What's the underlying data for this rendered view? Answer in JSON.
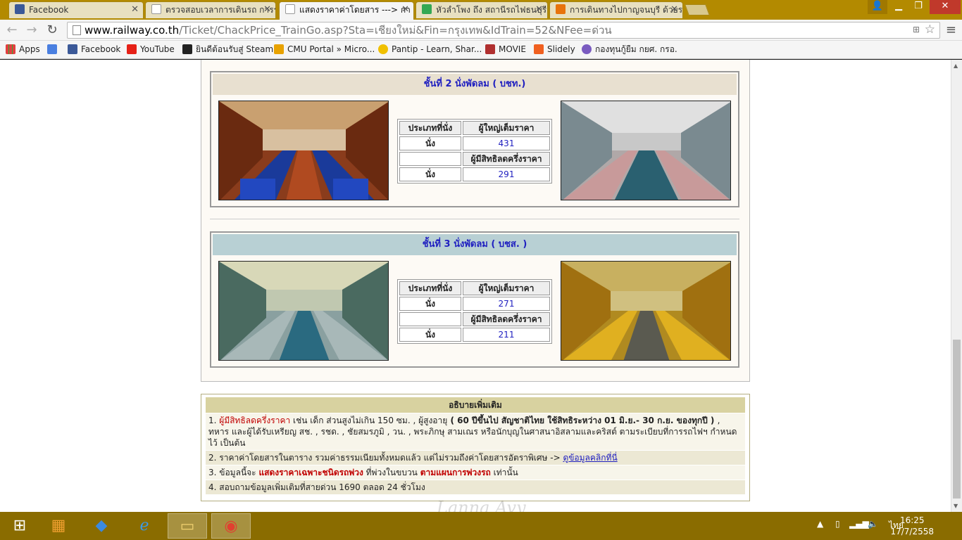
{
  "tabs": [
    {
      "title": "Facebook",
      "icon": "facebook-icon",
      "color": "#3b5998"
    },
    {
      "title": "ตรวจสอบเวลาการเดินรถ การร",
      "icon": "page-icon",
      "color": "#cccccc"
    },
    {
      "title": "แสดงราคาค่าโดยสาร ---> กา",
      "icon": "page-icon",
      "color": "#cccccc"
    },
    {
      "title": "หัวลำโพง ถึง สถานีรถไฟธนบุรี",
      "icon": "maps-icon",
      "color": "#34a853"
    },
    {
      "title": "การเดินทางไปกาญจนบุรี ด้วยร",
      "icon": "k-icon",
      "color": "#e8730c"
    }
  ],
  "address": {
    "host": "www.railway.co.th",
    "path": "/Ticket/ChackPrice_TrainGo.asp?Sta=เชียงใหม่&Fin=กรุงเทพ&IdTrain=52&NFee=ด่วน"
  },
  "bookmarks": [
    {
      "label": "Apps",
      "icon": "apps-grid-icon",
      "color": "#e04040"
    },
    {
      "label": "",
      "icon": "google-icon",
      "color": "#4a7fe0"
    },
    {
      "label": "Facebook",
      "icon": "facebook-icon",
      "color": "#3b5998"
    },
    {
      "label": "YouTube",
      "icon": "youtube-icon",
      "color": "#e62117"
    },
    {
      "label": "ยินดีต้อนรับสู่ Steam",
      "icon": "steam-icon",
      "color": "#222222"
    },
    {
      "label": "CMU Portal » Micro...",
      "icon": "cmu-icon",
      "color": "#e8a200"
    },
    {
      "label": "Pantip - Learn, Shar...",
      "icon": "pantip-icon",
      "color": "#f0c000"
    },
    {
      "label": "MOVIE",
      "icon": "movie-icon",
      "color": "#b03030"
    },
    {
      "label": "Slidely",
      "icon": "slidely-icon",
      "color": "#f06020"
    },
    {
      "label": "กองทุนกู้ยืม กยศ. กรอ.",
      "icon": "fund-icon",
      "color": "#7a5bc0"
    }
  ],
  "classes": [
    {
      "title": "ชั้นที่ 2 นั่งพัดลม ( บชท.)",
      "header_color": "#e8e0d0",
      "col_type": "ประเภทที่นั่ง",
      "col_adult": "ผู้ใหญ่เต็มราคา",
      "col_half": "ผู้มีสิทธิลดครึ่งราคา",
      "seat": "นั่ง",
      "adult_price": "431",
      "half_price": "291"
    },
    {
      "title": "ชั้นที่ 3 นั่งพัดลม ( บชส. )",
      "header_color": "#b8d0d4",
      "col_type": "ประเภทที่นั่ง",
      "col_adult": "ผู้ใหญ่เต็มราคา",
      "col_half": "ผู้มีสิทธิลดครึ่งราคา",
      "seat": "นั่ง",
      "adult_price": "271",
      "half_price": "211"
    }
  ],
  "info": {
    "heading": "อธิบายเพิ่มเติม",
    "r1_num": "1.",
    "r1_red": "ผู้มีสิทธิลดครึ่งราคา",
    "r1_a": " เช่น เด็ก ส่วนสูงไม่เกิน 150 ซม. , ผู้สูงอายุ",
    "r1_b": " ( 60 ปีขึ้นไป สัญชาติไทย ใช้สิทธิระหว่าง 01 มิ.ย.- 30 ก.ย. ของทุกปี ) ",
    "r1_c": ", ทหาร และผู้ได้รับเหรียญ สช. , รชด. , ชัยสมรภูมิ , วน. , พระภิกษุ สามเณร หรือนักบุญในศาสนาอิสลามและคริสต์ ตามระเบียบที่การรถไฟฯ กำหนดไว้ เป็นต้น",
    "r2_text": "2. ราคาค่าโดยสารในตาราง รวมค่าธรรมเนียมทั้งหมดแล้ว แต่ไม่รวมถึงค่าโดยสารอัตราพิเศษ -> ",
    "r2_link": "ดูข้อมูลคลิกที่นี่",
    "r3_a": "3. ข้อมูลนี้จะ ",
    "r3_red1": "แสดงราคาเฉพาะชนิดรถพ่วง",
    "r3_b": " ที่พ่วงในขบวน ",
    "r3_red2": "ตามแผนการพ่วงรถ",
    "r3_c": " เท่านั้น",
    "r4_text": "4. สอบถามข้อมูลเพิ่มเติมที่สายด่วน 1690 ตลอด 24 ชั่วโมง"
  },
  "taskbar": {
    "lang": "ไทย",
    "time": "16:25",
    "date": "17/7/2558"
  },
  "watermark": "Lanna Avy"
}
